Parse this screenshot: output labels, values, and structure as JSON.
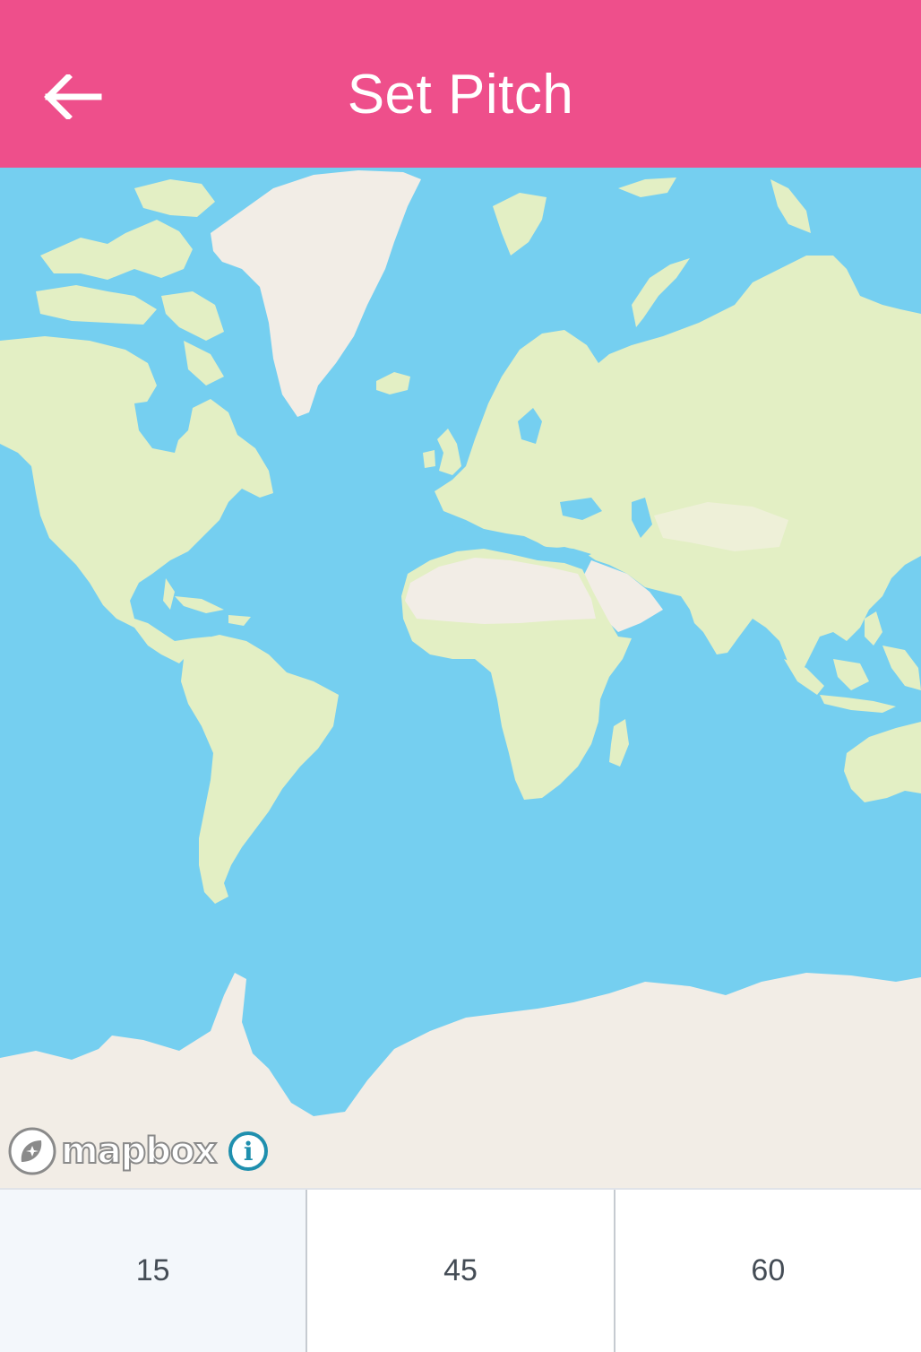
{
  "app_bar": {
    "title": "Set Pitch",
    "background": "#ee4f8b",
    "back_icon": "arrow-left-icon"
  },
  "map": {
    "provider_wordmark": "mapbox",
    "water_color": "#75cff0",
    "land_color": "#e3efc4",
    "ice_color": "#f2ede6",
    "info_icon": "info-icon"
  },
  "pitch_options": [
    {
      "label": "15",
      "selected": true
    },
    {
      "label": "45",
      "selected": false
    },
    {
      "label": "60",
      "selected": false
    }
  ]
}
